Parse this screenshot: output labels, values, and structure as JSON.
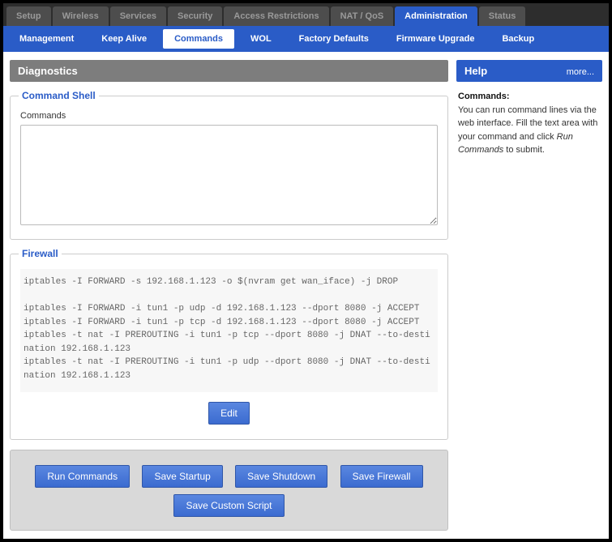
{
  "topnav": {
    "tabs": [
      {
        "label": "Setup"
      },
      {
        "label": "Wireless"
      },
      {
        "label": "Services"
      },
      {
        "label": "Security"
      },
      {
        "label": "Access Restrictions"
      },
      {
        "label": "NAT / QoS"
      },
      {
        "label": "Administration"
      },
      {
        "label": "Status"
      }
    ],
    "active_index": 6
  },
  "subnav": {
    "tabs": [
      {
        "label": "Management"
      },
      {
        "label": "Keep Alive"
      },
      {
        "label": "Commands"
      },
      {
        "label": "WOL"
      },
      {
        "label": "Factory Defaults"
      },
      {
        "label": "Firmware Upgrade"
      },
      {
        "label": "Backup"
      }
    ],
    "active_index": 2
  },
  "main": {
    "title": "Diagnostics",
    "command_shell": {
      "legend": "Command Shell",
      "label": "Commands",
      "value": ""
    },
    "firewall": {
      "legend": "Firewall",
      "rules": "iptables -I FORWARD -s 192.168.1.123 -o $(nvram get wan_iface) -j DROP\n\niptables -I FORWARD -i tun1 -p udp -d 192.168.1.123 --dport 8080 -j ACCEPT\niptables -I FORWARD -i tun1 -p tcp -d 192.168.1.123 --dport 8080 -j ACCEPT\niptables -t nat -I PREROUTING -i tun1 -p tcp --dport 8080 -j DNAT --to-destination 192.168.1.123\niptables -t nat -I PREROUTING -i tun1 -p udp --dport 8080 -j DNAT --to-destination 192.168.1.123",
      "edit_label": "Edit"
    },
    "actions": {
      "run": "Run Commands",
      "save_startup": "Save Startup",
      "save_shutdown": "Save Shutdown",
      "save_firewall": "Save Firewall",
      "save_custom": "Save Custom Script"
    }
  },
  "help": {
    "title": "Help",
    "more": "more...",
    "heading": "Commands:",
    "text_before": "You can run command lines via the web interface. Fill the text area with your command and click ",
    "emph": "Run Commands",
    "text_after": " to submit."
  }
}
